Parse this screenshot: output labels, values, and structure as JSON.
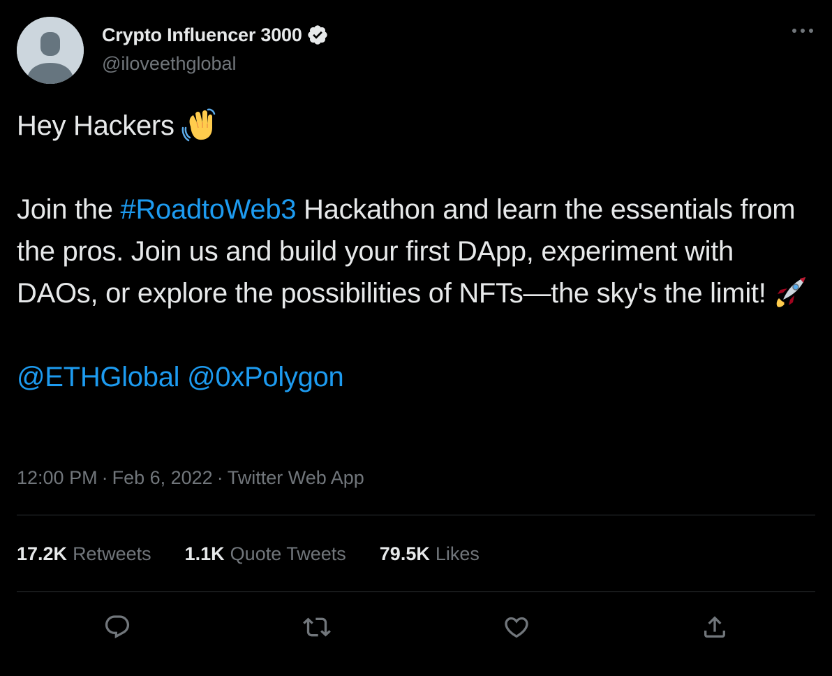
{
  "author": {
    "display_name": "Crypto Influencer 3000",
    "handle": "@iloveethglobal",
    "verified_icon": "verified-badge-icon"
  },
  "tweet": {
    "line1": "Hey Hackers",
    "p2_before": "Join the ",
    "hashtag": "#RoadtoWeb3",
    "p2_after": " Hackathon and learn the essentials from the pros. Join us and build your first DApp, experiment with DAOs, or explore the possibilities of NFTs—the sky's the limit!",
    "mention1": "@ETHGlobal",
    "mention2": "@0xPolygon",
    "emoji1": "waving-hand-emoji",
    "emoji2": "rocket-emoji"
  },
  "meta": {
    "time": "12:00 PM",
    "date": "Feb 6, 2022",
    "source": "Twitter Web App",
    "separator": "·"
  },
  "stats": {
    "retweets_count": "17.2K",
    "retweets_label": "Retweets",
    "quotes_count": "1.1K",
    "quotes_label": "Quote Tweets",
    "likes_count": "79.5K",
    "likes_label": "Likes"
  },
  "actions": [
    "reply-icon",
    "retweet-icon",
    "like-icon",
    "share-icon"
  ],
  "colors": {
    "background": "#000000",
    "text": "#e7e9ea",
    "secondary": "#71767b",
    "link": "#1d9bf0",
    "divider": "#2f3336"
  }
}
